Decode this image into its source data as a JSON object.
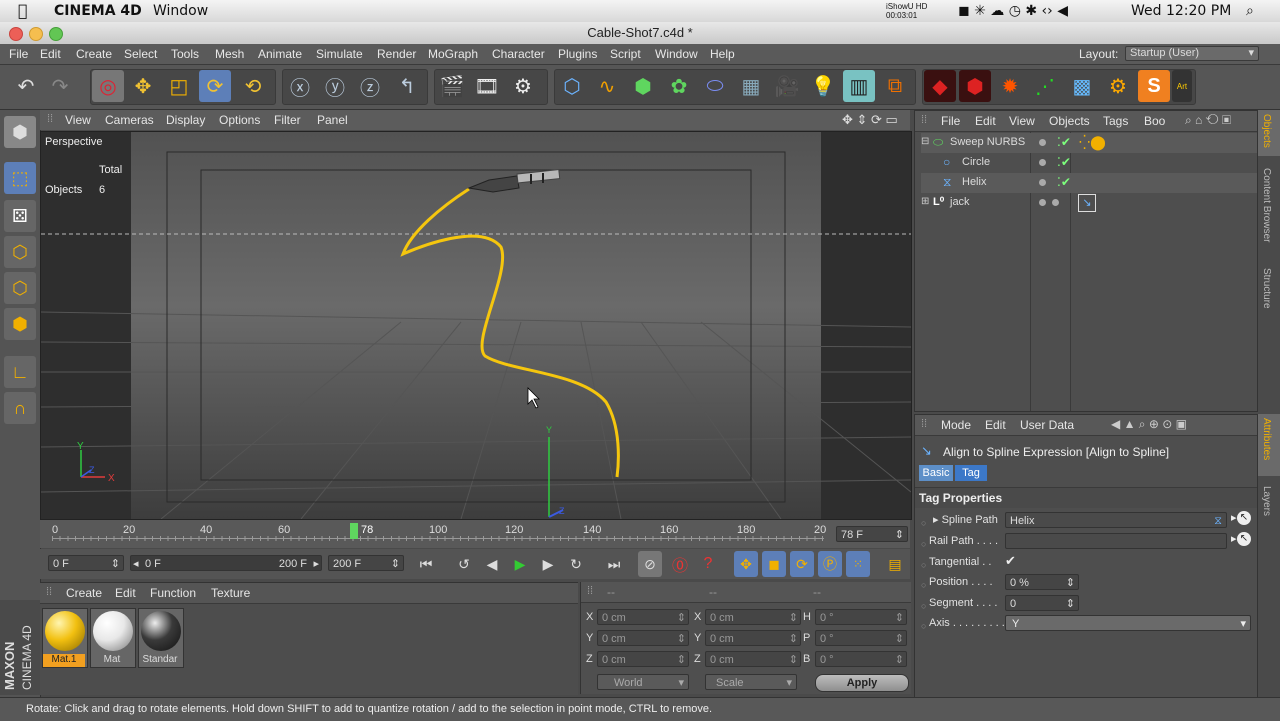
{
  "mac_menubar": {
    "app": "CINEMA 4D",
    "menu": "Window",
    "clock": "Wed 12:20 PM",
    "recorder": "iShowU HD",
    "recorder_time": "00:03:01"
  },
  "window": {
    "title": "Cable-Shot7.c4d *"
  },
  "main_menu": [
    "File",
    "Edit",
    "Create",
    "Select",
    "Tools",
    "Mesh",
    "Animate",
    "Simulate",
    "Render",
    "MoGraph",
    "Character",
    "Plugins",
    "Script",
    "Window",
    "Help"
  ],
  "layout": {
    "label": "Layout:",
    "value": "Startup (User)"
  },
  "viewport": {
    "menu": [
      "View",
      "Cameras",
      "Display",
      "Options",
      "Filter",
      "Panel"
    ],
    "name": "Perspective",
    "stats_header": "Total",
    "stats_label": "Objects",
    "stats_value": "6",
    "axis_x": "X",
    "axis_y": "Y",
    "axis_z": "Z",
    "gizmo_y": "Y",
    "gizmo_z": "Z"
  },
  "timeline": {
    "ticks": [
      "0",
      "20",
      "40",
      "60",
      "78",
      "100",
      "120",
      "140",
      "160",
      "180",
      "20"
    ],
    "current_frame": "78 F"
  },
  "transport": {
    "start": "0 F",
    "range_start": "0 F",
    "range_end": "200 F",
    "end": "200 F"
  },
  "material_panel": {
    "menu": [
      "Create",
      "Edit",
      "Function",
      "Texture"
    ],
    "materials": [
      {
        "name": "Mat.1",
        "color": "#f2c010",
        "selected": true
      },
      {
        "name": "Mat",
        "color": "#e8e8e8",
        "selected": false
      },
      {
        "name": "Standar",
        "color": "#3a3a3a",
        "selected": false
      }
    ],
    "brand": "MAXON",
    "brand_product": "CINEMA 4D"
  },
  "coord_panel": {
    "headers": [
      "--",
      "--",
      "--"
    ],
    "rows": [
      {
        "a": "X",
        "av": "0 cm",
        "b": "X",
        "bv": "0 cm",
        "c": "H",
        "cv": "0 °"
      },
      {
        "a": "Y",
        "av": "0 cm",
        "b": "Y",
        "bv": "0 cm",
        "c": "P",
        "cv": "0 °"
      },
      {
        "a": "Z",
        "av": "0 cm",
        "b": "Z",
        "bv": "0 cm",
        "c": "B",
        "cv": "0 °"
      }
    ],
    "space": "World",
    "mode": "Scale",
    "apply": "Apply"
  },
  "object_manager": {
    "menu": [
      "File",
      "Edit",
      "View",
      "Objects",
      "Tags",
      "Boo"
    ],
    "objects": [
      {
        "name": "Sweep NURBS",
        "indent": 0,
        "icon": "sweep-nurbs-icon"
      },
      {
        "name": "Circle",
        "indent": 1,
        "icon": "circle-spline-icon"
      },
      {
        "name": "Helix",
        "indent": 1,
        "icon": "helix-spline-icon"
      },
      {
        "name": "jack",
        "indent": 0,
        "icon": "null-object-icon"
      }
    ]
  },
  "attributes": {
    "menu": [
      "Mode",
      "Edit",
      "User Data"
    ],
    "title": "Align to Spline Expression [Align to Spline]",
    "tabs": [
      "Basic",
      "Tag"
    ],
    "section": "Tag Properties",
    "props": {
      "spline_path_label": "Spline Path",
      "spline_path_value": "Helix",
      "rail_path_label": "Rail Path . . . .",
      "tangential_label": "Tangential . .",
      "tangential_value": "✔",
      "position_label": "Position . . . .",
      "position_value": "0 %",
      "segment_label": "Segment . . . .",
      "segment_value": "0",
      "axis_label": "Axis . . . . . . . . .",
      "axis_value": "Y"
    }
  },
  "right_tabs": [
    "Objects",
    "Content Browser",
    "Structure",
    "Attributes",
    "Layers"
  ],
  "status": "Rotate: Click and drag to rotate elements. Hold down SHIFT to add to quantize rotation / add to the selection in point mode, CTRL to remove."
}
